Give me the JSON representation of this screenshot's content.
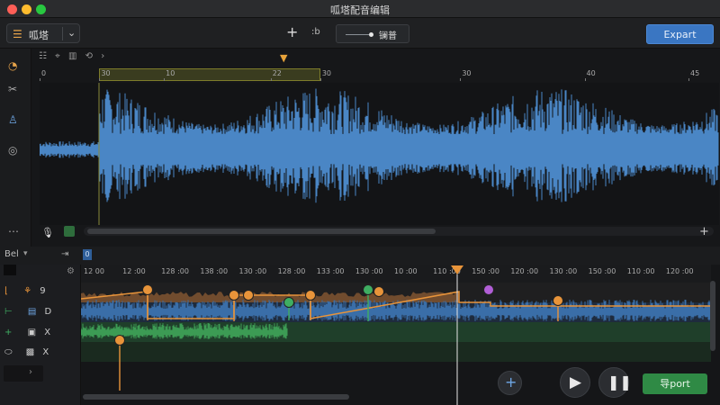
{
  "window": {
    "title": "呱塔配音编辑",
    "traffic_lights": {
      "close": "#ff5f57",
      "minimize": "#febc2e",
      "maximize": "#28c840"
    }
  },
  "toolbar": {
    "project_name": "呱塔",
    "project_icon": "list-icon",
    "add_label": "+",
    "mode_label": ":b",
    "edit_label": "镧普",
    "export_label": "Expart"
  },
  "sidebar": {
    "icons": [
      "speedometer-icon",
      "tools-icon",
      "person-icon",
      "disc-icon",
      "more-icon"
    ]
  },
  "upper": {
    "ruler_ticks": [
      {
        "label": "0",
        "pos": 0.0
      },
      {
        "label": "30",
        "pos": 0.088
      },
      {
        "label": "10",
        "pos": 0.183
      },
      {
        "label": "22",
        "pos": 0.34
      },
      {
        "label": "30",
        "pos": 0.413
      },
      {
        "label": "30",
        "pos": 0.619
      },
      {
        "label": "40",
        "pos": 0.802
      },
      {
        "label": "45",
        "pos": 0.955
      }
    ],
    "plus": "+"
  },
  "lower_header": {
    "label": "Bel",
    "dropdown": "▾",
    "track_icon_label": "0"
  },
  "tracks": [
    {
      "icon": "ruler-icon",
      "label": "9",
      "sub_icon": "crowd-icon"
    },
    {
      "icon": "line-icon",
      "label": "D",
      "sub_icon": "trash-icon"
    },
    {
      "icon": "plus-icon",
      "label": "X",
      "sub_icon": "print-icon"
    },
    {
      "icon": "oval-icon",
      "label": "X",
      "sub_icon": "box-icon"
    }
  ],
  "lower_ruler": [
    "12 00",
    "12 :00",
    "128 :00",
    "138 :00",
    "130 :00",
    "128 :00",
    "133 :00",
    "130 :00",
    "10 :00",
    "110 :00",
    "150 :00",
    "120 :00",
    "130 :00",
    "150 :00",
    "110 :00",
    "120 :00"
  ],
  "controls": {
    "add": "+",
    "import_label": "导port"
  },
  "colors": {
    "accent_blue": "#3a76c2",
    "wave_blue": "#4a86c5",
    "orange": "#e8943a",
    "green": "#2f8a45",
    "purple": "#b15ed6"
  }
}
